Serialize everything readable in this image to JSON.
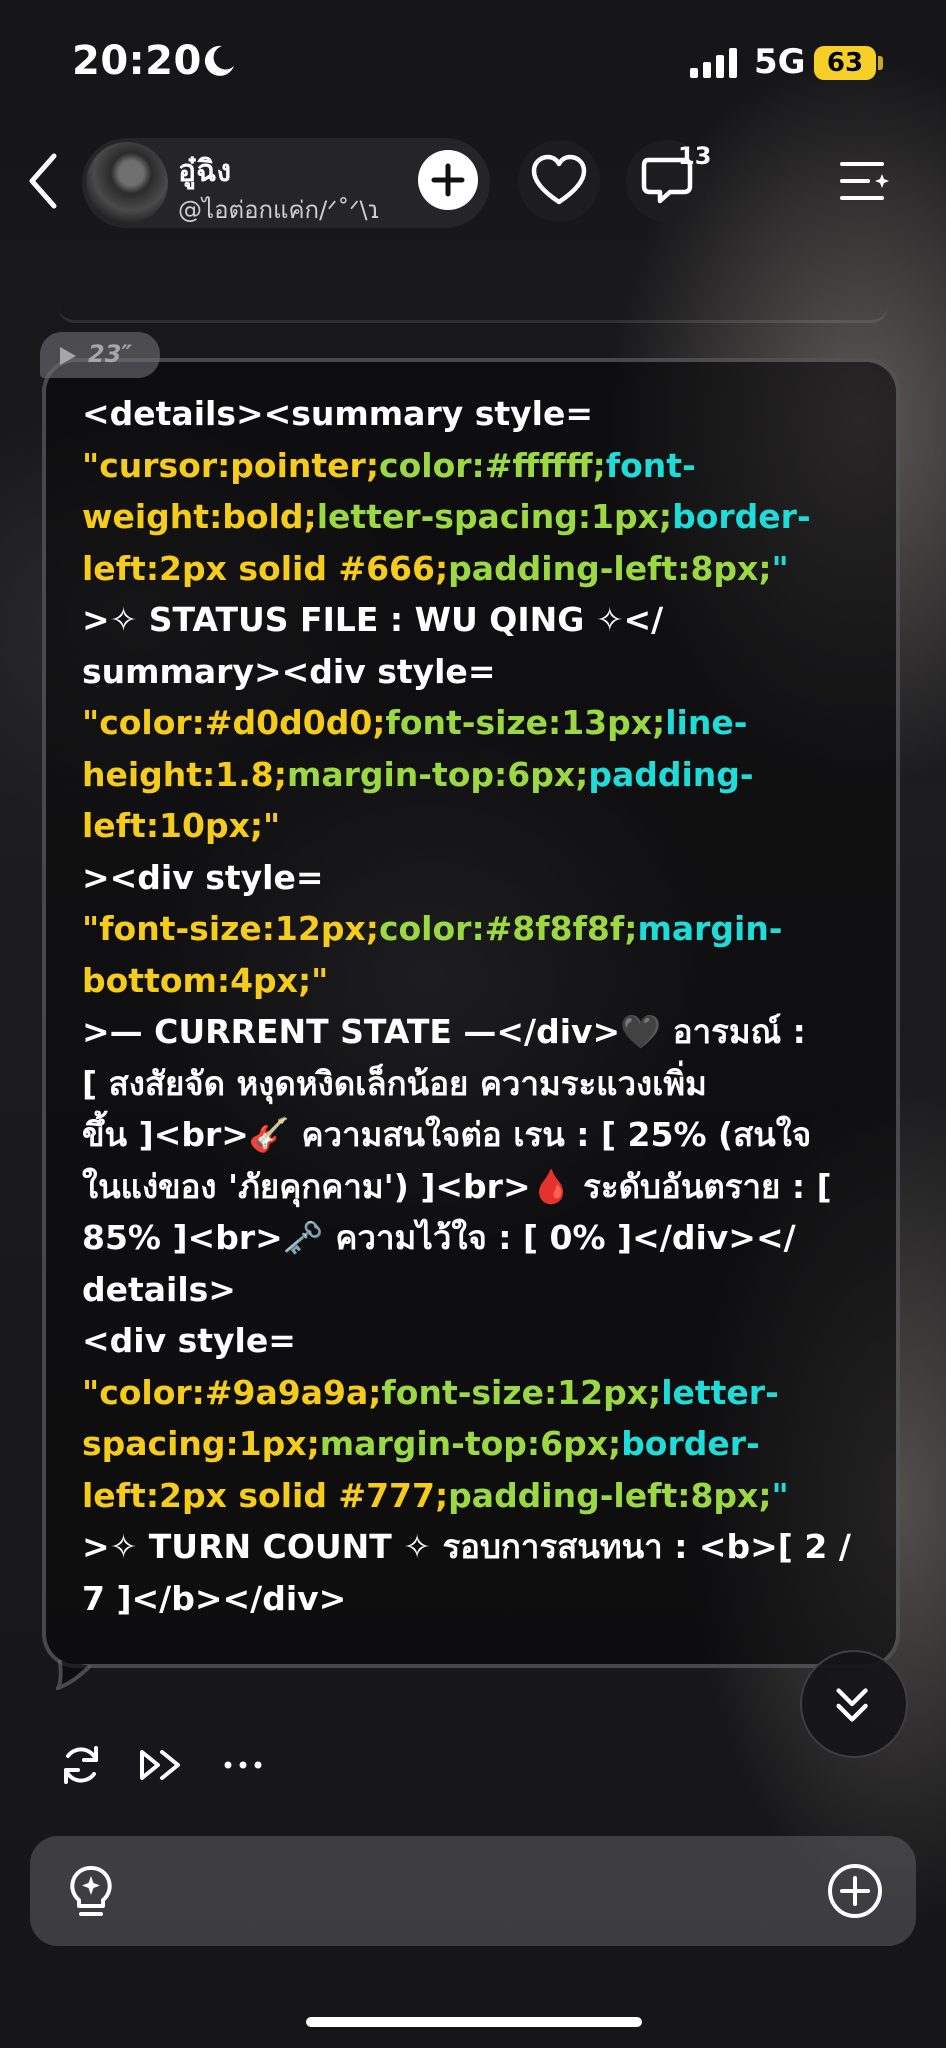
{
  "status_bar": {
    "time": "20:20",
    "network": "5G",
    "battery": "63",
    "battery_color": "#f6d028"
  },
  "header": {
    "back_icon": "chevron-left-icon",
    "profile_name": "อู๋ฉิง",
    "profile_handle": "@ไอต่อกแค่ก/ᐟ˚ᐟ\\ɿ",
    "follow_icon": "plus-icon",
    "like_icon": "heart-icon",
    "comment_icon": "comment-icon",
    "comment_count": "13",
    "menu_icon": "list-sparkle-icon"
  },
  "message": {
    "voice_duration": "23″",
    "lines": [
      [
        [
          "w",
          "<details><summary style="
        ]
      ],
      [
        [
          "y",
          "\"cursor:pointer;"
        ],
        [
          "g",
          "color:#ffffff;"
        ],
        [
          "c",
          "font-"
        ]
      ],
      [
        [
          "y",
          "weight:bold;"
        ],
        [
          "g",
          "letter-spacing:1px;"
        ],
        [
          "c",
          "border-"
        ]
      ],
      [
        [
          "y",
          "left:2px solid #666;"
        ],
        [
          "g",
          "padding-left:8px;"
        ],
        [
          "c",
          "\""
        ]
      ],
      [
        [
          "w",
          ">✧ STATUS FILE : WU QING ✧</"
        ]
      ],
      [
        [
          "w",
          "summary><div style="
        ]
      ],
      [
        [
          "y",
          "\"color:#d0d0d0;"
        ],
        [
          "g",
          "font-size:13px;"
        ],
        [
          "c",
          "line-"
        ]
      ],
      [
        [
          "y",
          "height:1.8;"
        ],
        [
          "g",
          "margin-top:6px;"
        ],
        [
          "c",
          "padding-"
        ]
      ],
      [
        [
          "y",
          "left:10px;\""
        ]
      ],
      [
        [
          "w",
          "><div style="
        ]
      ],
      [
        [
          "y",
          "\"font-size:12px;"
        ],
        [
          "g",
          "color:#8f8f8f;"
        ],
        [
          "c",
          "margin-"
        ]
      ],
      [
        [
          "y",
          "bottom:4px;\""
        ]
      ],
      [
        [
          "w",
          ">— CURRENT STATE —</div>🖤 อารมณ์ :"
        ]
      ],
      [
        [
          "w",
          "[ สงสัยจัด หงุดหงิดเล็กน้อย ความระแวงเพิ่ม"
        ]
      ],
      [
        [
          "w",
          "ขึ้น ]<br>🎸 ความสนใจต่อ เรน : [ 25% (สนใจ"
        ]
      ],
      [
        [
          "w",
          "ในแง่ของ 'ภัยคุกคาม') ]<br>🩸 ระดับอันตราย : ["
        ]
      ],
      [
        [
          "w",
          "85% ]<br>🗝️ ความไว้ใจ : [ 0% ]</div></"
        ]
      ],
      [
        [
          "w",
          "details>"
        ]
      ],
      [
        [
          "w",
          "<div style="
        ]
      ],
      [
        [
          "y",
          "\"color:#9a9a9a;"
        ],
        [
          "g",
          "font-size:12px;"
        ],
        [
          "c",
          "letter-"
        ]
      ],
      [
        [
          "y",
          "spacing:1px;"
        ],
        [
          "g",
          "margin-top:6px;"
        ],
        [
          "c",
          "border-"
        ]
      ],
      [
        [
          "y",
          "left:2px solid #777;"
        ],
        [
          "g",
          "padding-left:8px;"
        ],
        [
          "c",
          "\""
        ]
      ],
      [
        [
          "w",
          ">✧ TURN COUNT ✧ รอบการสนทนา : <b>[ 2 /"
        ]
      ],
      [
        [
          "w",
          "7 ]</b></div>"
        ]
      ]
    ]
  },
  "actions": {
    "regenerate_icon": "refresh-icon",
    "continue_icon": "fast-forward-icon",
    "more_icon": "more-icon",
    "scroll_down_icon": "double-chevron-down-icon"
  },
  "input": {
    "idea_icon": "lightbulb-sparkle-icon",
    "add_icon": "plus-circle-icon"
  },
  "colors": {
    "syntax_white": "#ffffff",
    "syntax_yellow": "#f6cc1c",
    "syntax_green": "#9bd843",
    "syntax_cyan": "#1fdcd8"
  }
}
